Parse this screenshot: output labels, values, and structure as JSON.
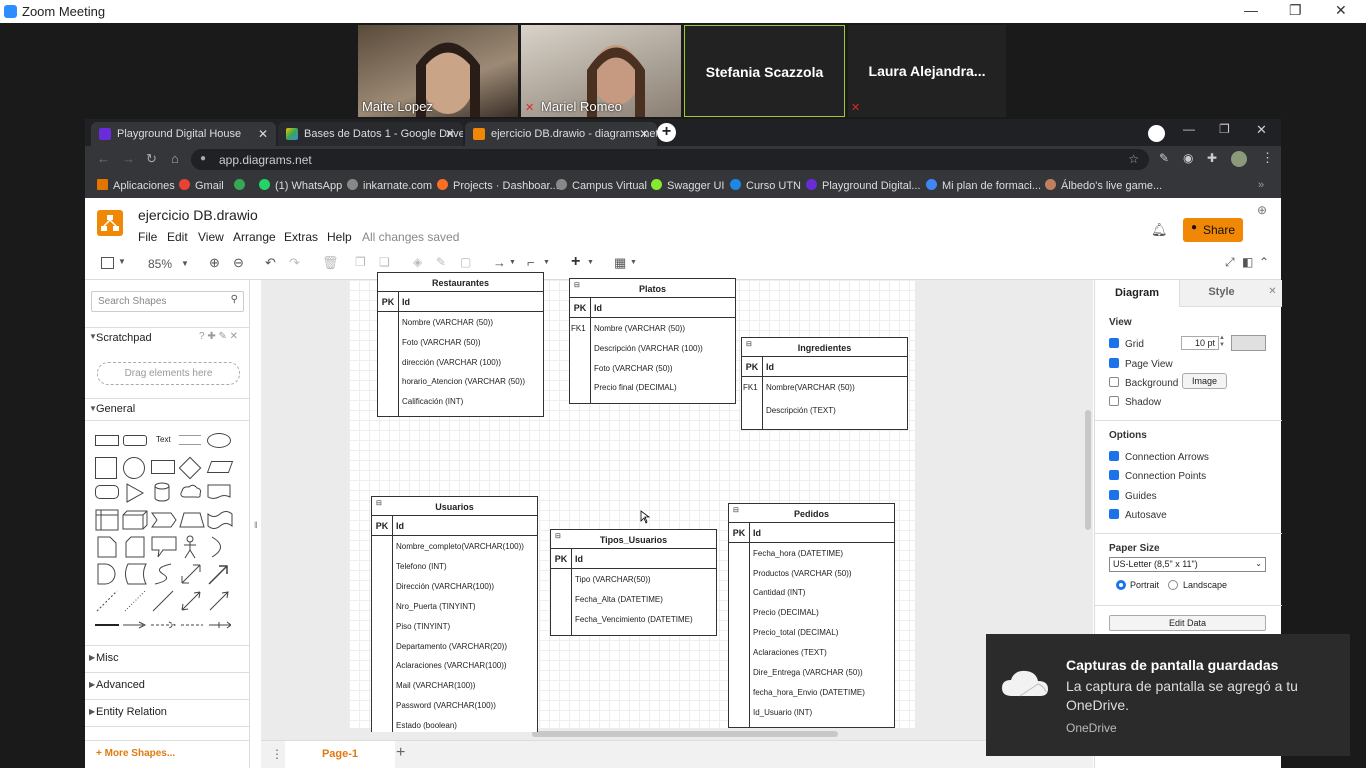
{
  "zoom": {
    "title": "Zoom Meeting",
    "participants": [
      {
        "name": "Maite Lopez"
      },
      {
        "name": "Mariel Romeo"
      },
      {
        "name": "Stefania Scazzola"
      },
      {
        "name": "Laura  Alejandra..."
      }
    ]
  },
  "browser": {
    "tabs": [
      {
        "label": "Playground Digital House"
      },
      {
        "label": "Bases de Datos 1 - Google Drive"
      },
      {
        "label": "ejercicio DB.drawio - diagrams.net"
      }
    ],
    "url": "app.diagrams.net",
    "bookmarks": [
      "Aplicaciones",
      "Gmail",
      "",
      "(1) WhatsApp",
      "inkarnate.com",
      "Projects · Dashboar...",
      "Campus Virtual",
      "Swagger UI",
      "Curso UTN",
      "Playground Digital...",
      "Mi plan de formaci...",
      "Álbedo's live game..."
    ]
  },
  "drawio": {
    "doc_title": "ejercicio DB.drawio",
    "menu": [
      "File",
      "Edit",
      "View",
      "Arrange",
      "Extras",
      "Help"
    ],
    "saved_status": "All changes saved",
    "share_label": "Share",
    "zoom_level": "85%",
    "search_placeholder": "Search Shapes",
    "scratchpad": "Scratchpad",
    "drag_here": "Drag elements here",
    "general": "General",
    "shape_text": "Text",
    "sections": [
      "Misc",
      "Advanced",
      "Entity Relation"
    ],
    "more_shapes": "+ More Shapes...",
    "page_tab": "Page-1",
    "right_tabs": {
      "diagram": "Diagram",
      "style": "Style"
    },
    "view_label": "View",
    "grid": "Grid",
    "grid_size": "10 pt",
    "page_view": "Page View",
    "background": "Background",
    "image_btn": "Image",
    "shadow": "Shadow",
    "options_label": "Options",
    "options": [
      "Connection Arrows",
      "Connection Points",
      "Guides",
      "Autosave"
    ],
    "paper_size_label": "Paper Size",
    "paper_size": "US-Letter (8,5\" x 11\")",
    "portrait": "Portrait",
    "landscape": "Landscape",
    "edit_data": "Edit Data"
  },
  "diagram": {
    "restaurantes": {
      "title": "Restaurantes",
      "pk": "PK",
      "id": "Id",
      "fields": [
        "Nombre (VARCHAR (50))",
        "Foto (VARCHAR (50))",
        "dirección (VARCHAR (100))",
        "horario_Atencion (VARCHAR (50))",
        "Calificación (INT)"
      ]
    },
    "platos": {
      "title": "Platos",
      "pk": "PK",
      "id": "Id",
      "fk": "FK1",
      "fields": [
        "Nombre (VARCHAR (50))",
        "Descripción (VARCHAR (100))",
        "Foto (VARCHAR (50))",
        "Precio final (DECIMAL)"
      ]
    },
    "ingredientes": {
      "title": "Ingredientes",
      "pk": "PK",
      "id": "Id",
      "fk": "FK1",
      "fields": [
        "Nombre(VARCHAR (50))",
        "Descripción (TEXT)"
      ]
    },
    "usuarios": {
      "title": "Usuarios",
      "pk": "PK",
      "id": "Id",
      "fields": [
        "Nombre_completo(VARCHAR(100))",
        "Telefono (INT)",
        "Dirección (VARCHAR(100))",
        "Nro_Puerta (TINYINT)",
        "Piso (TINYINT)",
        "Departamento (VARCHAR(20))",
        "Aclaraciones (VARCHAR(100))",
        "Mail (VARCHAR(100))",
        "Password (VARCHAR(100))",
        "Estado (boolean)"
      ]
    },
    "tipos": {
      "title": "Tipos_Usuarios",
      "pk": "PK",
      "id": "Id",
      "fields": [
        "Tipo (VARCHAR(50))",
        "Fecha_Alta (DATETIME)",
        "Fecha_Vencimiento (DATETIME)"
      ]
    },
    "pedidos": {
      "title": "Pedidos",
      "pk": "PK",
      "id": "Id",
      "fields": [
        "Fecha_hora (DATETIME)",
        "Productos (VARCHAR (50))",
        "Cantidad (INT)",
        "Precio (DECIMAL)",
        "Precio_total (DECIMAL)",
        "Aclaraciones (TEXT)",
        "Dire_Entrega (VARCHAR (50))",
        "fecha_hora_Envio (DATETIME)",
        "Id_Usuario (INT)"
      ]
    }
  },
  "toast": {
    "title": "Capturas de pantalla guardadas",
    "body": "La captura de pantalla se agregó a tu OneDrive.",
    "source": "OneDrive"
  }
}
